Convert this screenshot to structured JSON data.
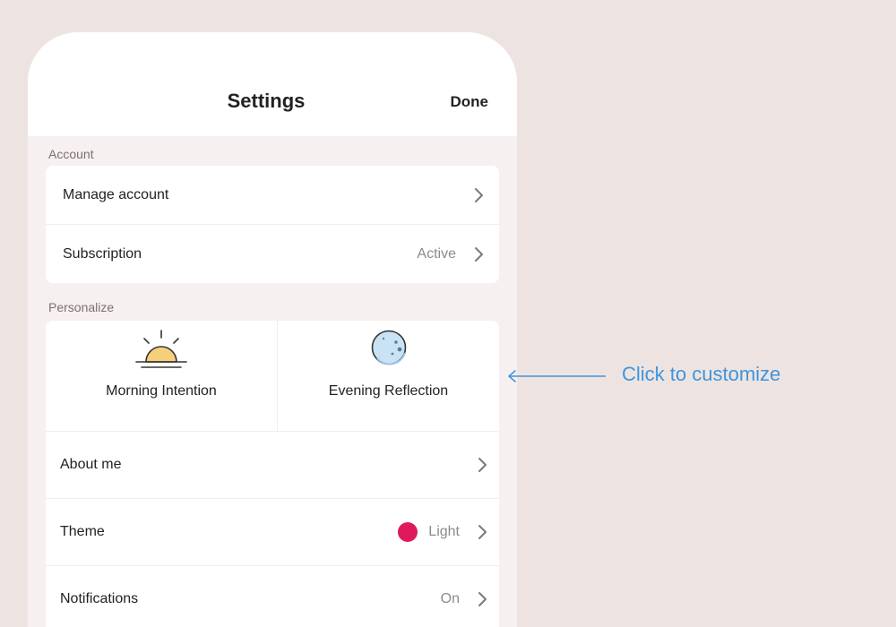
{
  "header": {
    "title": "Settings",
    "done_label": "Done"
  },
  "account": {
    "section_label": "Account",
    "rows": [
      {
        "label": "Manage account",
        "value": ""
      },
      {
        "label": "Subscription",
        "value": "Active"
      }
    ]
  },
  "personalize": {
    "section_label": "Personalize",
    "tiles": [
      {
        "label": "Morning Intention",
        "icon": "sunrise-icon"
      },
      {
        "label": "Evening Reflection",
        "icon": "moon-icon"
      }
    ],
    "rows": [
      {
        "label": "About me",
        "value": ""
      },
      {
        "label": "Theme",
        "value": "Light",
        "swatch_color": "#e0195c"
      },
      {
        "label": "Notifications",
        "value": "On"
      }
    ]
  },
  "annotation": {
    "text": "Click to customize",
    "color": "#3f94dc"
  },
  "colors": {
    "background": "#ede4e2",
    "screen": "#f7f0f0",
    "sun_fill": "#f6cf7a",
    "moon_fill": "#c9e3f5"
  }
}
